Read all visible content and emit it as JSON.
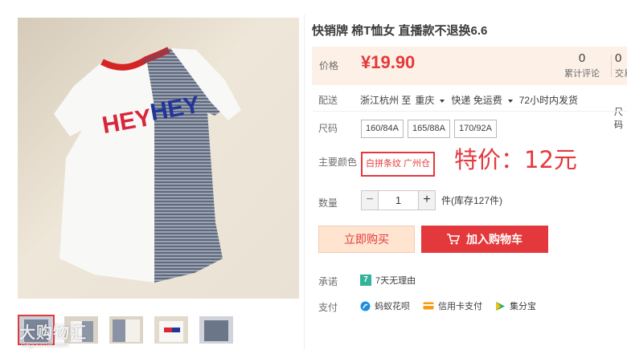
{
  "product": {
    "title": "快销牌 棉T恤女 直播款不退换6.6",
    "print_left": "HEY",
    "print_right": "HEY"
  },
  "price": {
    "label": "价格",
    "value": "¥19.90"
  },
  "stats": {
    "reviews_count": "0",
    "reviews_label": "累计评论",
    "trades_count": "0",
    "trades_label": "交易成"
  },
  "shipping": {
    "label": "配送",
    "origin": "浙江杭州 至",
    "destination": "重庆",
    "method": "快递 免运费",
    "dispatch": "72小时内发货",
    "cut_text": "尺码"
  },
  "size": {
    "label": "尺码",
    "options": [
      "160/84A",
      "165/88A",
      "170/92A"
    ]
  },
  "color": {
    "label": "主要颜色",
    "selected": "白拼条纹 广州仓"
  },
  "special_price": "特价：12元",
  "quantity": {
    "label": "数量",
    "minus": "−",
    "value": "1",
    "plus": "+",
    "stock": "件(库存127件)"
  },
  "actions": {
    "buy_now": "立即购买",
    "add_cart": "加入购物车"
  },
  "promise": {
    "label": "承诺",
    "icon_text": "7",
    "text": "7天无理由"
  },
  "payment": {
    "label": "支付",
    "methods": [
      "蚂蚁花呗",
      "信用卡支付",
      "集分宝"
    ]
  },
  "watermark": {
    "text": "大购物汇",
    "sub": "dagoumai.com"
  },
  "colors": {
    "accent": "#e4393c",
    "price_bg": "#fdf0e6",
    "buy_now_bg": "#ffe4d0",
    "promise_green": "#31b49a"
  },
  "icons": {
    "cart": "cart-icon",
    "promise": "seven-day-icon",
    "huabei": "ant-huabei-icon",
    "credit_card": "credit-card-icon",
    "jifenbao": "jifenbao-icon"
  }
}
